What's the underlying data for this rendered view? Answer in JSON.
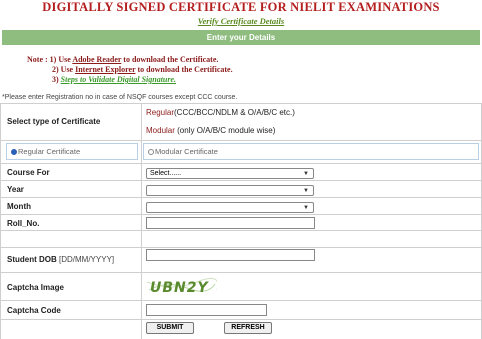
{
  "header": {
    "title": "DIGITALLY SIGNED CERTIFICATE FOR NIELIT EXAMINATIONS",
    "verify_link": "Verify Certificate Details",
    "section_bar": "Enter your Details"
  },
  "note": {
    "label": "Note :",
    "line1_prefix": "1) Use ",
    "line1_link": "Adobe Reader",
    "line1_suffix": " to download the Certificate.",
    "line2_prefix": "2) Use ",
    "line2_link": "Internet Explorer",
    "line2_suffix": " to download the Certificate.",
    "line3_prefix": "3) ",
    "line3_link": "Steps to Validate Digital Signature."
  },
  "nsqf_note": "*Please enter Registration no in case of NSQF courses except CCC course.",
  "form": {
    "cert_type_label": "Select type of Certificate",
    "regular_desc_accent": "Regular",
    "regular_desc_rest": "(CCC/BCC/NDLM & O/A/B/C etc.)",
    "modular_desc_accent": "Modular",
    "modular_desc_rest": " (only O/A/B/C module wise)",
    "radio_regular": "Regular Certificate",
    "radio_modular": "Modular Certificate",
    "course_label": "Course For",
    "course_value": "Select......",
    "year_label": "Year",
    "year_value": "",
    "month_label": "Month",
    "month_value": "",
    "roll_label": "Roll_No.",
    "dob_label": "Student DOB",
    "dob_hint": " [DD/MM/YYYY]",
    "captcha_image_label": "Captcha Image",
    "captcha_text": "UBN2Y",
    "captcha_code_label": "Captcha Code",
    "submit": "SUBMIT",
    "refresh": "REFRESH"
  },
  "colors": {
    "title": "#b41e1e",
    "bar": "#8fbc7f",
    "note": "#8b1a1a",
    "link_green": "#3a9a2a"
  }
}
